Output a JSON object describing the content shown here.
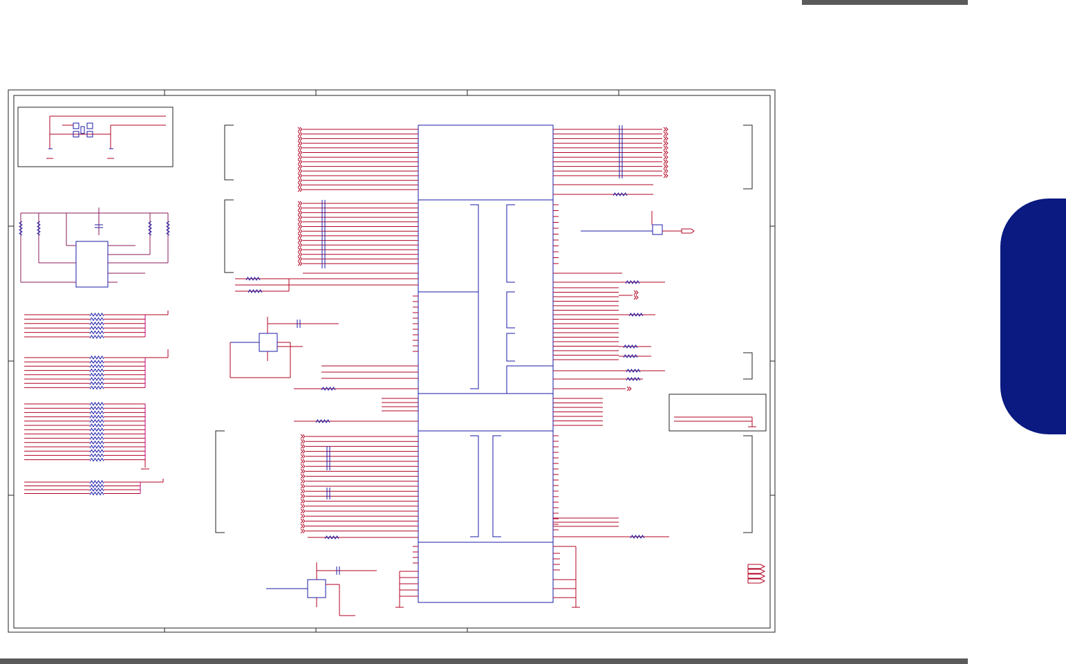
{
  "page": {
    "header_bar_color": "#5a5a5a",
    "footer_bar_color": "#5a5a5a",
    "side_tab_color": "#0a1a80"
  },
  "schematic": {
    "wire_color": "#b00020",
    "component_color": "#1a1aa8",
    "frame_color": "#222222",
    "junction_color": "#c0007a",
    "resistor_color": "#1a1aa8",
    "bus_symbol": "wave-lines"
  }
}
